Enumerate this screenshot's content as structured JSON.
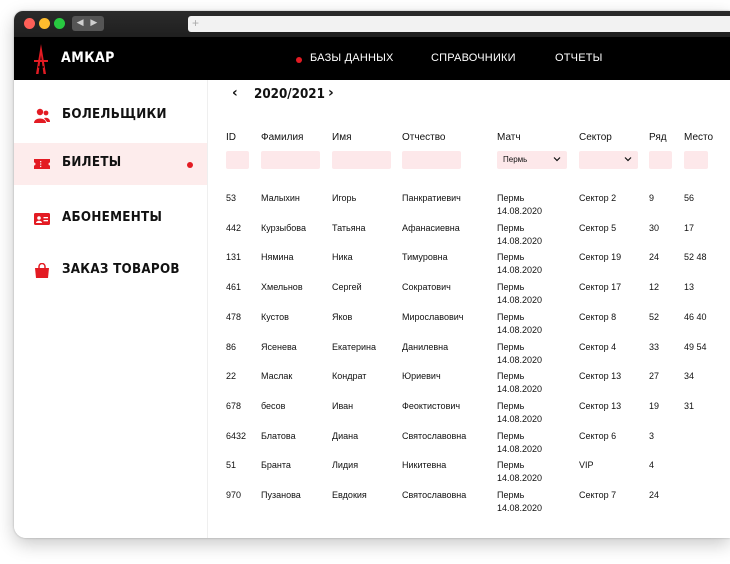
{
  "browser": {
    "nav_arrows": "◀ ▶",
    "new_tab": "+"
  },
  "header": {
    "brand": "АМКАР",
    "nav": [
      "БАЗЫ ДАННЫХ",
      "СПРАВОЧНИКИ",
      "ОТЧЕТЫ"
    ],
    "active_nav_index": 0,
    "accent_color": "#e31b23"
  },
  "sidebar": {
    "items": [
      {
        "label": "БОЛЕЛЬЩИКИ",
        "icon": "fans-icon"
      },
      {
        "label": "БИЛЕТЫ",
        "icon": "ticket-icon",
        "active": true
      },
      {
        "label": "АБОНЕМЕНТЫ",
        "icon": "id-card-icon"
      },
      {
        "label": "ЗАКАЗ ТОВАРОВ",
        "icon": "shopping-bag-icon"
      }
    ]
  },
  "season": {
    "prev": "‹",
    "label": "2020/2021",
    "next": "›"
  },
  "table": {
    "headers": [
      "ID",
      "Фамилия",
      "Имя",
      "Отчество",
      "Матч",
      "Сектор",
      "Ряд",
      "Место"
    ],
    "filters": {
      "match_value": "Пермь",
      "sector_value": ""
    },
    "rows": [
      {
        "id": "53",
        "last": "Малыхин",
        "first": "Игорь",
        "middle": "Панкратиевич",
        "match_city": "Пермь",
        "match_date": "14.08.2020",
        "sector": "Сектор 2",
        "row": "9",
        "seat": "56"
      },
      {
        "id": "442",
        "last": "Курзыбова",
        "first": "Татьяна",
        "middle": "Афанасиевна",
        "match_city": "Пермь",
        "match_date": "14.08.2020",
        "sector": "Сектор 5",
        "row": "30",
        "seat": "17"
      },
      {
        "id": "131",
        "last": "Нямина",
        "first": "Ника",
        "middle": "Тимуровна",
        "match_city": "Пермь",
        "match_date": "14.08.2020",
        "sector": "Сектор 19",
        "row": "24",
        "seat": "52 48"
      },
      {
        "id": "461",
        "last": "Хмельнов",
        "first": "Сергей",
        "middle": "Сократович",
        "match_city": "Пермь",
        "match_date": "14.08.2020",
        "sector": "Сектор 17",
        "row": "12",
        "seat": "13"
      },
      {
        "id": "478",
        "last": "Кустов",
        "first": "Яков",
        "middle": "Мирославович",
        "match_city": "Пермь",
        "match_date": "14.08.2020",
        "sector": "Сектор 8",
        "row": "52",
        "seat": "46 40"
      },
      {
        "id": "86",
        "last": "Ясенева",
        "first": "Екатерина",
        "middle": "Данилевна",
        "match_city": "Пермь",
        "match_date": "14.08.2020",
        "sector": "Сектор 4",
        "row": "33",
        "seat": "49 54"
      },
      {
        "id": "22",
        "last": "Маслак",
        "first": "Кондрат",
        "middle": "Юриевич",
        "match_city": "Пермь",
        "match_date": "14.08.2020",
        "sector": "Сектор 13",
        "row": "27",
        "seat": "34"
      },
      {
        "id": "678",
        "last": "бесов",
        "first": "Иван",
        "middle": "Феоктистович",
        "match_city": "Пермь",
        "match_date": "14.08.2020",
        "sector": "Сектор 13",
        "row": "19",
        "seat": "31"
      },
      {
        "id": "6432",
        "last": "Блатова",
        "first": "Диана",
        "middle": "Святославовна",
        "match_city": "Пермь",
        "match_date": "14.08.2020",
        "sector": "Сектор 6",
        "row": "3",
        "seat": ""
      },
      {
        "id": "51",
        "last": "Бранта",
        "first": "Лидия",
        "middle": "Никитевна",
        "match_city": "Пермь",
        "match_date": "14.08.2020",
        "sector": "VIP",
        "row": "4",
        "seat": ""
      },
      {
        "id": "970",
        "last": "Пузанова",
        "first": "Евдокия",
        "middle": "Святославовна",
        "match_city": "Пермь",
        "match_date": "14.08.2020",
        "sector": "Сектор 7",
        "row": "24",
        "seat": ""
      }
    ]
  }
}
